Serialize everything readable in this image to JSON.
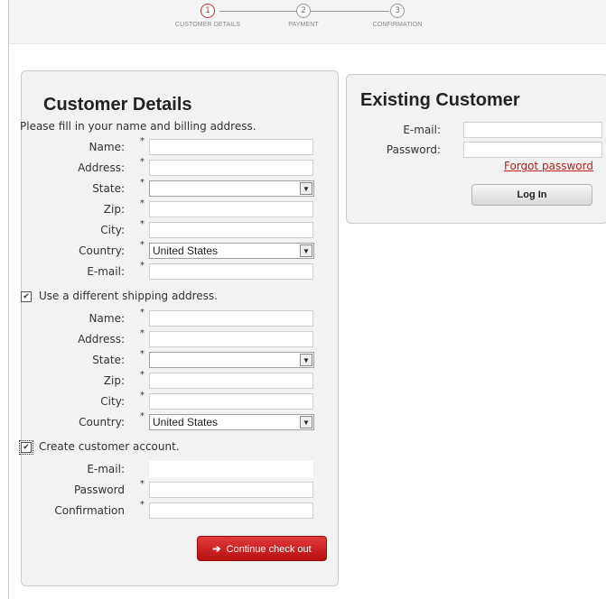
{
  "steps": [
    {
      "num": "1",
      "label": "CUSTOMER DETAILS"
    },
    {
      "num": "2",
      "label": "PAYMENT"
    },
    {
      "num": "3",
      "label": "CONFIRMATION"
    }
  ],
  "colors": {
    "accent": "#c33333",
    "step_active": "#cc3333",
    "button_red": "#c41e1e"
  },
  "customer": {
    "title": "Customer Details",
    "intro": "Please fill in your name and billing address.",
    "billing": {
      "name_label": "Name:",
      "address_label": "Address:",
      "state_label": "State:",
      "zip_label": "Zip:",
      "city_label": "City:",
      "country_label": "Country:",
      "country_value": "United States",
      "email_label": "E-mail:"
    },
    "shipping_checkbox_label": "Use a different shipping address.",
    "shipping": {
      "name_label": "Name:",
      "address_label": "Address:",
      "state_label": "State:",
      "zip_label": "Zip:",
      "city_label": "City:",
      "country_label": "Country:",
      "country_value": "United States"
    },
    "account_checkbox_label": "Create customer account.",
    "account": {
      "email_label": "E-mail:",
      "password_label": "Password",
      "confirmation_label": "Confirmation"
    },
    "required_mark": "*",
    "continue_label": "Continue check out",
    "continue_icon": "arrow-right-icon"
  },
  "existing": {
    "title": "Existing Customer",
    "email_label": "E-mail:",
    "password_label": "Password:",
    "forgot_label": "Forgot password",
    "login_label": "Log In"
  }
}
